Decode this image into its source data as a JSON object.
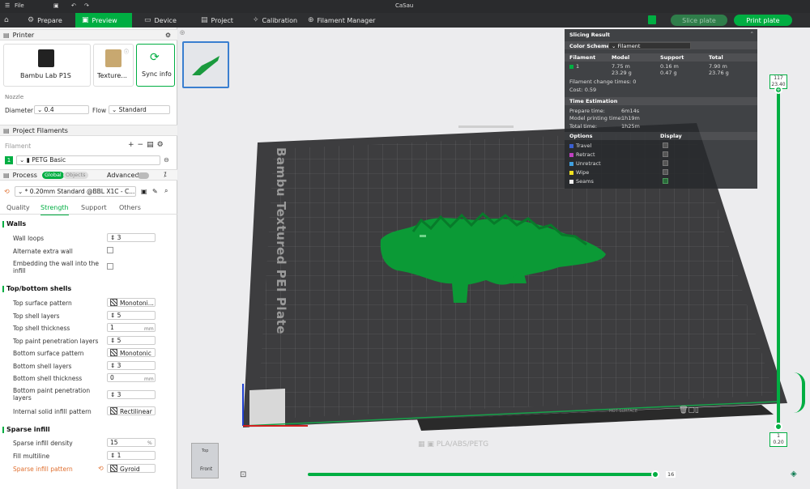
{
  "titlebar": {
    "menu": "File",
    "title": "CaSau"
  },
  "nav": {
    "prepare": "Prepare",
    "preview": "Preview",
    "device": "Device",
    "project": "Project",
    "calibration": "Calibration",
    "filament_manager": "Filament Manager",
    "slice_plate": "Slice plate",
    "print_plate": "Print plate"
  },
  "printer": {
    "section": "Printer",
    "name": "Bambu Lab P1S",
    "plate": "Texture...",
    "sync": "Sync info",
    "nozzle_label": "Nozzle",
    "diameter_label": "Diameter",
    "diameter": "0.4",
    "flow_label": "Flow",
    "flow": "Standard"
  },
  "filaments": {
    "section": "Project Filaments",
    "label": "Filament",
    "slot": "1",
    "name": "PETG Basic"
  },
  "process": {
    "section": "Process",
    "global": "Global",
    "objects": "Objects",
    "advanced": "Advanced",
    "profile": "* 0.20mm Standard @BBL X1C - C...",
    "tabs": [
      "Quality",
      "Strength",
      "Support",
      "Others"
    ]
  },
  "walls": {
    "title": "Walls",
    "wall_loops_label": "Wall loops",
    "wall_loops": "3",
    "alt_extra_wall": "Alternate extra wall",
    "embed_wall": "Embedding the wall into the infill"
  },
  "shells": {
    "title": "Top/bottom shells",
    "top_pattern_label": "Top surface pattern",
    "top_pattern": "Monotoni...",
    "top_layers_label": "Top shell layers",
    "top_layers": "5",
    "top_thick_label": "Top shell thickness",
    "top_thick": "1",
    "top_paint_label": "Top paint penetration layers",
    "top_paint": "5",
    "bot_pattern_label": "Bottom surface pattern",
    "bot_pattern": "Monotonic",
    "bot_layers_label": "Bottom shell layers",
    "bot_layers": "3",
    "bot_thick_label": "Bottom shell thickness",
    "bot_thick": "0",
    "bot_paint_label": "Bottom paint penetration layers",
    "bot_paint": "3",
    "internal_label": "Internal solid infill pattern",
    "internal": "Rectilinear",
    "mm": "mm"
  },
  "infill": {
    "title": "Sparse infill",
    "density_label": "Sparse infill density",
    "density": "15",
    "pct": "%",
    "multiline_label": "Fill multiline",
    "multiline": "1",
    "pattern_label": "Sparse infill pattern",
    "pattern": "Gyroid"
  },
  "slicing": {
    "title": "Slicing Result",
    "scheme_label": "Color Scheme",
    "scheme": "Filament",
    "cols": [
      "Filament",
      "Model",
      "Support",
      "Total"
    ],
    "slot": "1",
    "model_m": "7.75 m",
    "model_g": "23.29 g",
    "support_m": "0.16 m",
    "support_g": "0.47 g",
    "total_m": "7.90 m",
    "total_g": "23.76 g",
    "change_times": "Filament change times: 0",
    "cost": "Cost: 0.59",
    "time_title": "Time Estimation",
    "prepare_label": "Prepare time:",
    "prepare": "6m14s",
    "model_time_label": "Model printing time:",
    "model_time": "1h19m",
    "total_time_label": "Total time:",
    "total_time": "1h25m",
    "options_label": "Options",
    "display_label": "Display",
    "options": [
      {
        "name": "Travel",
        "color": "#3a5fd0"
      },
      {
        "name": "Retract",
        "color": "#c040c0"
      },
      {
        "name": "Unretract",
        "color": "#40a0e0"
      },
      {
        "name": "Wipe",
        "color": "#f0e020"
      },
      {
        "name": "Seams",
        "color": "#f0f0f0"
      }
    ]
  },
  "plate": {
    "bed_text": "Bambu Textured PEI Plate",
    "bottom_text": "PLA/ABS/PETG",
    "hot": "HOT SURFACE"
  },
  "layer_slider": {
    "top_a": "117",
    "top_b": "23.40",
    "bot_a": "1",
    "bot_b": "0.20",
    "h_value": "16"
  },
  "viewcube": {
    "top": "Top",
    "front": "Front"
  },
  "colors": {
    "accent": "#00ae42",
    "model": "#0b9a36"
  }
}
